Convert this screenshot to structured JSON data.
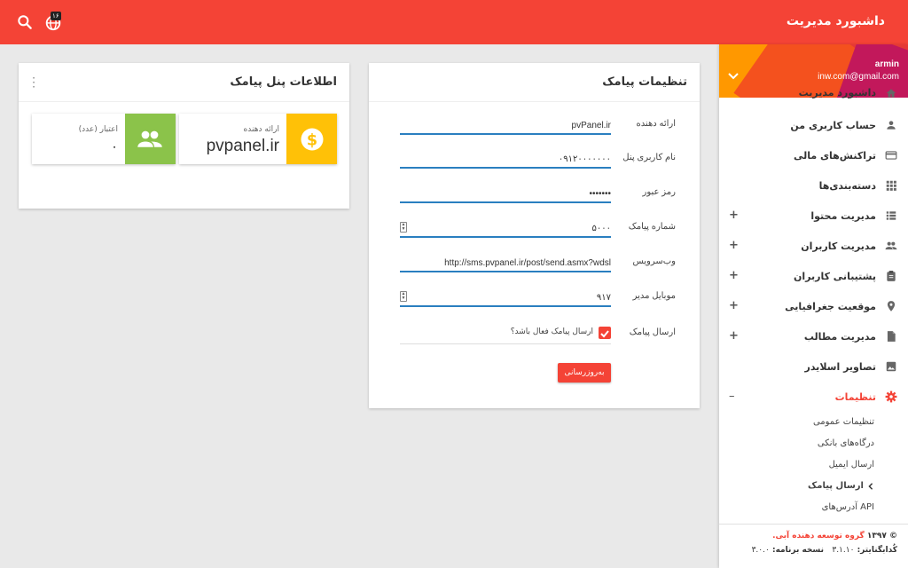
{
  "topbar": {
    "title": "داشبورد مدیریت",
    "badge": "۱۶",
    "accent": "#f44336"
  },
  "profile": {
    "name": "armin",
    "email": "inw.com@gmail.com"
  },
  "sidebar": {
    "items": [
      {
        "label": "داشبورد مدیریت",
        "icon": "home-icon",
        "plus": false
      },
      {
        "label": "حساب کاربری من",
        "icon": "person-icon",
        "plus": false
      },
      {
        "label": "تراکنش‌های مالی",
        "icon": "credit-card-icon",
        "plus": false
      },
      {
        "label": "دسته‌بندی‌ها",
        "icon": "grid-icon",
        "plus": false
      },
      {
        "label": "مدیریت محتوا",
        "icon": "list-icon",
        "plus": true
      },
      {
        "label": "مدیریت کاربران",
        "icon": "people-icon",
        "plus": true
      },
      {
        "label": "پشتیبانی کاربران",
        "icon": "clipboard-icon",
        "plus": true
      },
      {
        "label": "موقعیت جغرافیایی",
        "icon": "location-pin-icon",
        "plus": true
      },
      {
        "label": "مدیریت مطالب",
        "icon": "document-icon",
        "plus": true
      },
      {
        "label": "تصاویر اسلایدر",
        "icon": "image-icon",
        "plus": false
      },
      {
        "label": "تنظیمات",
        "icon": "gear-icon",
        "plus": false,
        "collapse": "–"
      }
    ],
    "sub": [
      "تنظیمات عمومی",
      "درگاه‌های بانکی",
      "ارسال ایمیل",
      "ارسال پیامک",
      "آدرس‌های API"
    ]
  },
  "footer": {
    "copy": "© ۱۳۹۷",
    "org": "گروه توسعه دهنده آبی.",
    "coder_label": "کُدابگنایتر:",
    "coder_value": "۳.۱.۱۰",
    "version_label": "نسخه برنامه:",
    "version_value": "۳.۰.۰"
  },
  "sms_settings": {
    "title": "تنظیمات پیامک",
    "fields": [
      {
        "label": "ارائه دهنده",
        "value": "pvPanel.ir"
      },
      {
        "label": "نام کاربری پنل",
        "value": "۰۹۱۲۰۰۰۰۰۰۰"
      },
      {
        "label": "رمز عبور",
        "value": "•••••••"
      },
      {
        "label": "شماره پیامک",
        "value": "۵۰۰۰"
      },
      {
        "label": "وب‌سرویس",
        "value": "http://sms.pvpanel.ir/post/send.asmx?wdsl"
      },
      {
        "label": "موبایل مدیر",
        "value": "۹۱۷"
      }
    ],
    "send_label": "ارسال پیامک",
    "checkbox_label": "ارسال پیامک فعال باشد؟",
    "submit": "به‌روزرسانی"
  },
  "panel_info": {
    "title": "اطلاعات پنل پیامک",
    "provider_label": "ارائه دهنده",
    "provider_value": "pvpanel.ir",
    "credit_label": "اعتبار (عدد)",
    "credit_value": "۰",
    "provider_color": "#ffc107",
    "credit_color": "#8bc34a"
  }
}
